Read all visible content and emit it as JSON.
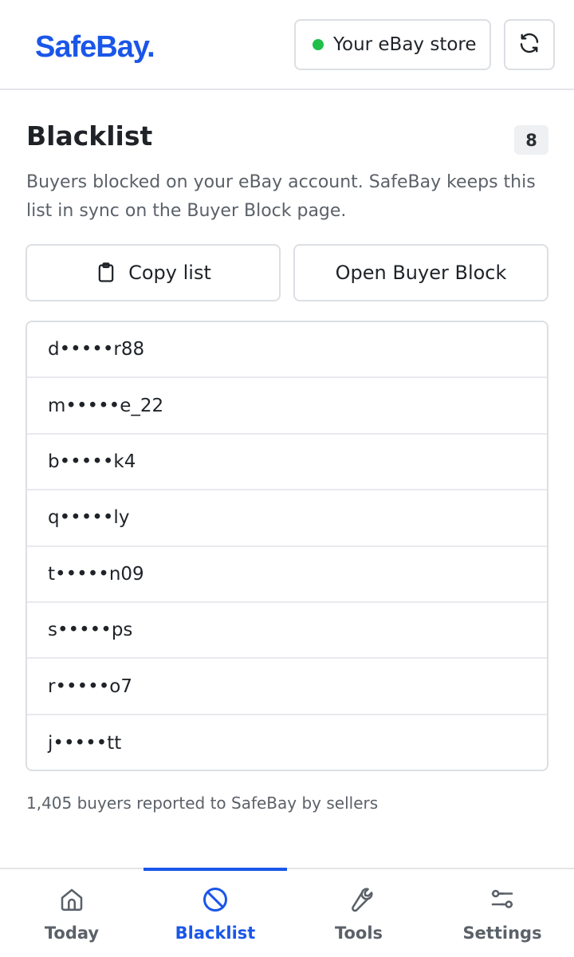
{
  "header": {
    "logo": "SafeBay.",
    "store_label": "Your eBay store",
    "store_status_color": "#1fbf4a",
    "refresh_icon": "refresh-icon"
  },
  "main": {
    "title": "Blacklist",
    "count": "8",
    "description": "Buyers blocked on your eBay account. SafeBay keeps this list in sync on the Buyer Block page.",
    "copy_button": "Copy list",
    "copy_icon": "clipboard-icon",
    "open_button": "Open Buyer Block",
    "buyers": [
      "d•••••r88",
      "m•••••e_22",
      "b•••••k4",
      "q•••••ly",
      "t•••••n09",
      "s•••••ps",
      "r•••••o7",
      "j•••••tt"
    ],
    "footer_note": "1,405 buyers reported to SafeBay by sellers"
  },
  "nav": {
    "items": [
      {
        "label": "Today",
        "icon": "home-icon",
        "active": false
      },
      {
        "label": "Blacklist",
        "icon": "block-icon",
        "active": true
      },
      {
        "label": "Tools",
        "icon": "wrench-icon",
        "active": false
      },
      {
        "label": "Settings",
        "icon": "sliders-icon",
        "active": false
      }
    ]
  },
  "colors": {
    "accent": "#1a56e8",
    "text": "#1f2328",
    "muted": "#5b6169"
  }
}
